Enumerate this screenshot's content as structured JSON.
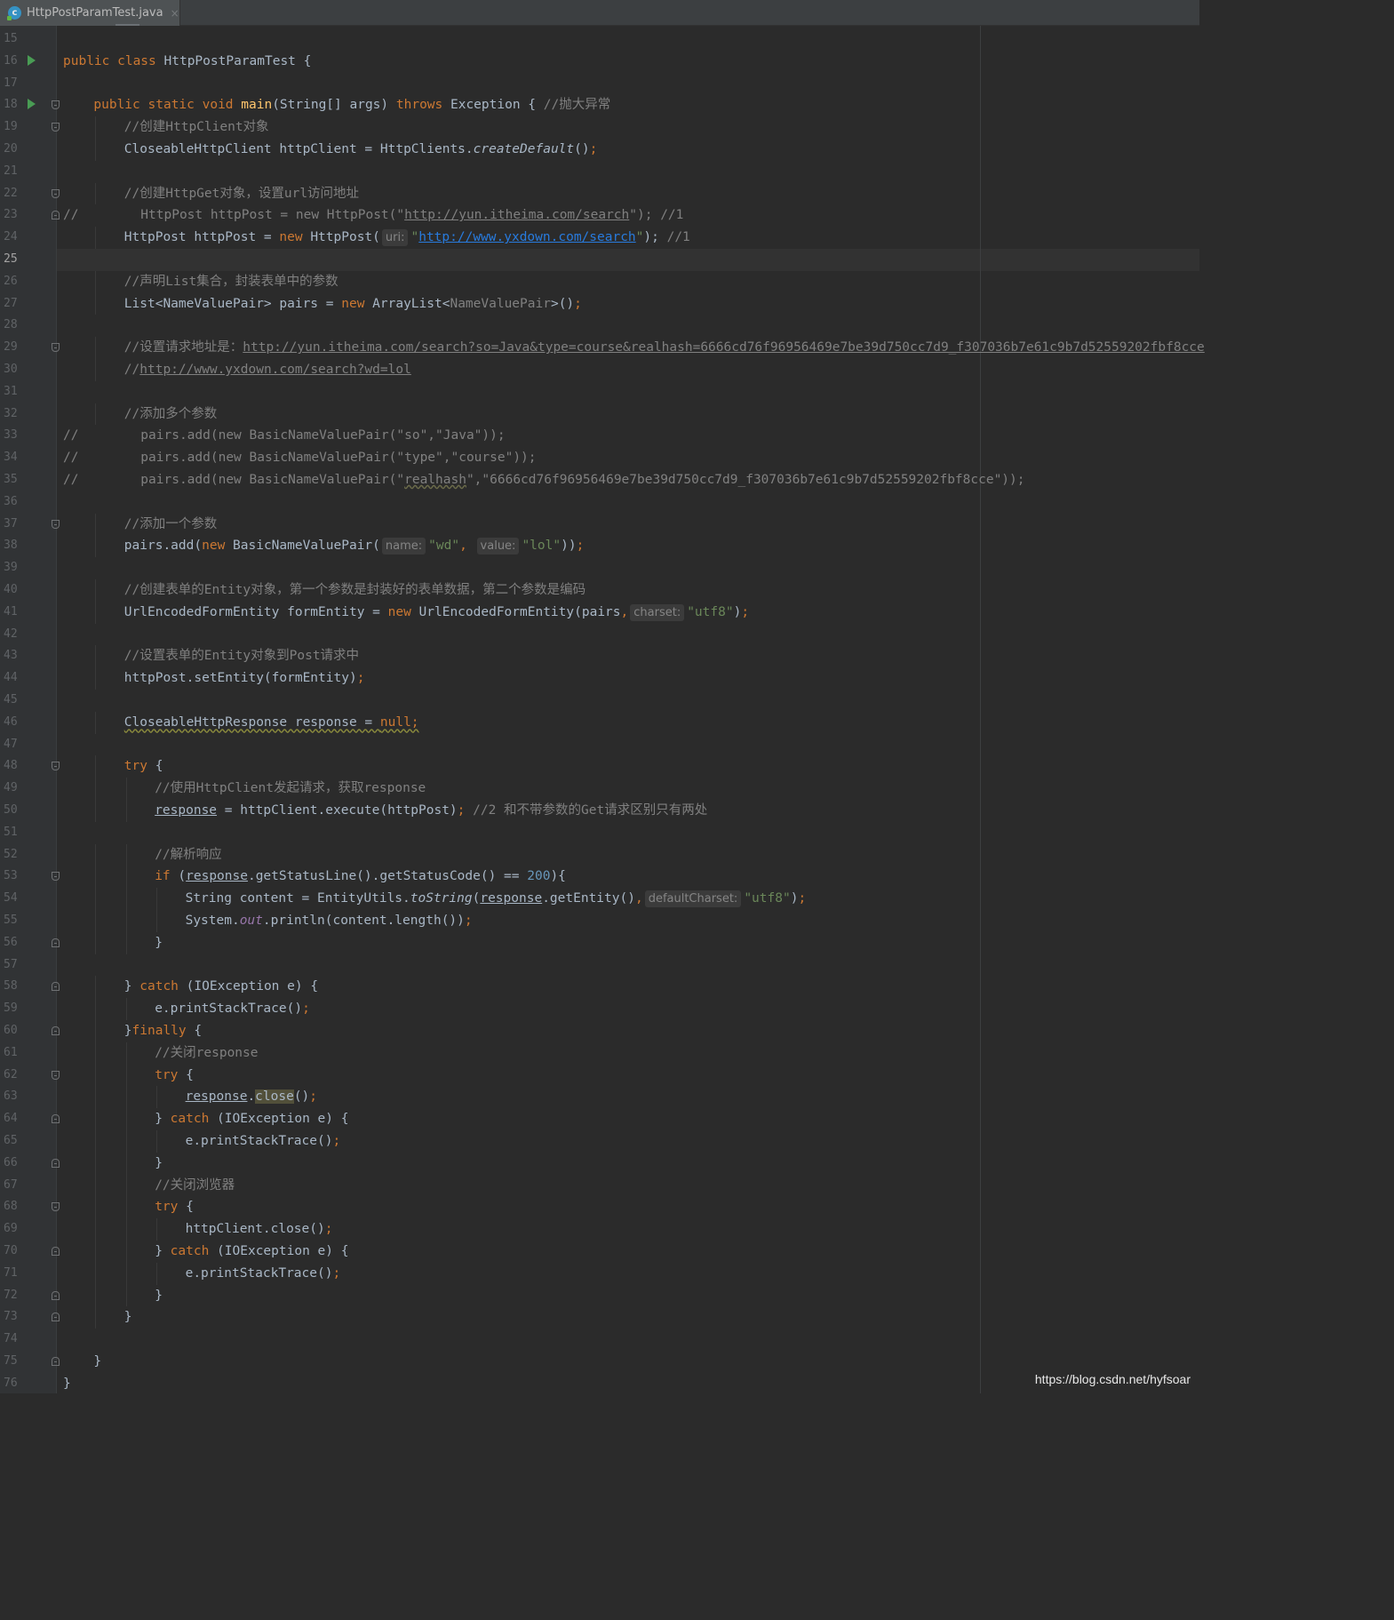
{
  "tab": {
    "filename": "HttpPostParamTest.java",
    "icon": "java-class-icon",
    "close": "×"
  },
  "current_line": 25,
  "run_marker_lines": [
    16,
    18
  ],
  "fold_lines": [
    18,
    19,
    22,
    23,
    29,
    37,
    48,
    53,
    56,
    58,
    60,
    62,
    64,
    66,
    68,
    70,
    72,
    73,
    75
  ],
  "lines": [
    {
      "n": 15,
      "indent": 0,
      "t": []
    },
    {
      "n": 16,
      "indent": 0,
      "t": [
        [
          "kw",
          "public class "
        ],
        [
          "",
          "HttpPostParamTest {"
        ]
      ]
    },
    {
      "n": 17,
      "indent": 0,
      "t": []
    },
    {
      "n": 18,
      "indent": 1,
      "t": [
        [
          "kw",
          "public static void "
        ],
        [
          "fn",
          "main"
        ],
        [
          "",
          "(String[] args) "
        ],
        [
          "kw",
          "throws "
        ],
        [
          "",
          "Exception { "
        ],
        [
          "cm",
          "//抛大异常"
        ]
      ]
    },
    {
      "n": 19,
      "indent": 2,
      "t": [
        [
          "cm",
          "//创建HttpClient对象"
        ]
      ]
    },
    {
      "n": 20,
      "indent": 2,
      "t": [
        [
          "",
          "CloseableHttpClient httpClient = HttpClients."
        ],
        [
          "it",
          "createDefault"
        ],
        [
          "",
          "()"
        ],
        [
          "kw",
          ";"
        ]
      ]
    },
    {
      "n": 21,
      "indent": 0,
      "t": []
    },
    {
      "n": 22,
      "indent": 2,
      "t": [
        [
          "cm",
          "//创建HttpGet对象，设置url访问地址"
        ]
      ]
    },
    {
      "n": 23,
      "indent": 0,
      "t": [
        [
          "cm",
          "//        HttpPost httpPost = new HttpPost(\""
        ],
        [
          "cml",
          "http://yun.itheima.com/search"
        ],
        [
          "cm",
          "\"); //1"
        ]
      ]
    },
    {
      "n": 24,
      "indent": 2,
      "t": [
        [
          "",
          "HttpPost httpPost = "
        ],
        [
          "kw",
          "new "
        ],
        [
          "",
          "HttpPost("
        ],
        [
          "hint",
          "uri:"
        ],
        [
          "str",
          "\""
        ],
        [
          "link",
          "http://www.yxdown.com/search"
        ],
        [
          "str",
          "\""
        ],
        [
          "",
          "); "
        ],
        [
          "cm",
          "//1"
        ]
      ]
    },
    {
      "n": 25,
      "indent": 0,
      "t": []
    },
    {
      "n": 26,
      "indent": 2,
      "t": [
        [
          "cm",
          "//声明List集合，封装表单中的参数"
        ]
      ]
    },
    {
      "n": 27,
      "indent": 2,
      "t": [
        [
          "",
          "List<NameValuePair> pairs = "
        ],
        [
          "kw",
          "new "
        ],
        [
          "",
          "ArrayList<"
        ],
        [
          "gen",
          "NameValuePair"
        ],
        [
          "",
          ">()"
        ],
        [
          "kw",
          ";"
        ]
      ]
    },
    {
      "n": 28,
      "indent": 0,
      "t": []
    },
    {
      "n": 29,
      "indent": 2,
      "t": [
        [
          "cm",
          "//设置请求地址是："
        ],
        [
          "cml",
          "http://yun.itheima.com/search?so=Java&type=course&realhash=6666cd76f96956469e7be39d750cc7d9_f307036b7e61c9b7d52559202fbf8cce"
        ]
      ]
    },
    {
      "n": 30,
      "indent": 2,
      "t": [
        [
          "cm",
          "//"
        ],
        [
          "cml",
          "http://www.yxdown.com/search?wd=lol"
        ]
      ]
    },
    {
      "n": 31,
      "indent": 0,
      "t": []
    },
    {
      "n": 32,
      "indent": 2,
      "t": [
        [
          "cm",
          "//添加多个参数"
        ]
      ]
    },
    {
      "n": 33,
      "indent": 0,
      "t": [
        [
          "cm",
          "//        pairs.add(new BasicNameValuePair(\"so\",\"Java\"));"
        ]
      ]
    },
    {
      "n": 34,
      "indent": 0,
      "t": [
        [
          "cm",
          "//        pairs.add(new BasicNameValuePair(\"type\",\"course\"));"
        ]
      ]
    },
    {
      "n": 35,
      "indent": 0,
      "t": [
        [
          "cm",
          "//        pairs.add(new BasicNameValuePair(\""
        ],
        [
          "cmw",
          "realhash"
        ],
        [
          "cm",
          "\",\"6666cd76f96956469e7be39d750cc7d9_f307036b7e61c9b7d52559202fbf8cce\"));"
        ]
      ]
    },
    {
      "n": 36,
      "indent": 0,
      "t": []
    },
    {
      "n": 37,
      "indent": 2,
      "t": [
        [
          "cm",
          "//添加一个参数"
        ]
      ]
    },
    {
      "n": 38,
      "indent": 2,
      "t": [
        [
          "",
          "pairs.add("
        ],
        [
          "kw",
          "new "
        ],
        [
          "",
          "BasicNameValuePair("
        ],
        [
          "hint",
          "name:"
        ],
        [
          "str",
          "\"wd\""
        ],
        [
          "kw",
          ", "
        ],
        [
          "hint",
          "value:"
        ],
        [
          "str",
          "\"lol\""
        ],
        [
          "",
          "))"
        ],
        [
          "kw",
          ";"
        ]
      ]
    },
    {
      "n": 39,
      "indent": 0,
      "t": []
    },
    {
      "n": 40,
      "indent": 2,
      "t": [
        [
          "cm",
          "//创建表单的Entity对象，第一个参数是封装好的表单数据，第二个参数是编码"
        ]
      ]
    },
    {
      "n": 41,
      "indent": 2,
      "t": [
        [
          "",
          "UrlEncodedFormEntity formEntity = "
        ],
        [
          "kw",
          "new "
        ],
        [
          "",
          "UrlEncodedFormEntity(pairs"
        ],
        [
          "kw",
          ","
        ],
        [
          "hint",
          "charset:"
        ],
        [
          "str",
          "\"utf8\""
        ],
        [
          "",
          ")"
        ],
        [
          "kw",
          ";"
        ]
      ]
    },
    {
      "n": 42,
      "indent": 0,
      "t": []
    },
    {
      "n": 43,
      "indent": 2,
      "t": [
        [
          "cm",
          "//设置表单的Entity对象到Post请求中"
        ]
      ]
    },
    {
      "n": 44,
      "indent": 2,
      "t": [
        [
          "",
          "httpPost.setEntity(formEntity)"
        ],
        [
          "kw",
          ";"
        ]
      ]
    },
    {
      "n": 45,
      "indent": 0,
      "t": []
    },
    {
      "n": 46,
      "indent": 2,
      "t": [
        [
          "warn",
          "CloseableHttpResponse response = "
        ],
        [
          "warnkw",
          "null;"
        ]
      ]
    },
    {
      "n": 47,
      "indent": 0,
      "t": []
    },
    {
      "n": 48,
      "indent": 2,
      "t": [
        [
          "kw",
          "try "
        ],
        [
          "",
          "{"
        ]
      ]
    },
    {
      "n": 49,
      "indent": 3,
      "t": [
        [
          "cm",
          "//使用HttpClient发起请求，获取response"
        ]
      ]
    },
    {
      "n": 50,
      "indent": 3,
      "t": [
        [
          "ul",
          "response"
        ],
        [
          "",
          " = httpClient.execute(httpPost)"
        ],
        [
          "kw",
          "; "
        ],
        [
          "cm",
          "//2 和不带参数的Get请求区别只有两处"
        ]
      ]
    },
    {
      "n": 51,
      "indent": 0,
      "t": []
    },
    {
      "n": 52,
      "indent": 3,
      "t": [
        [
          "cm",
          "//解析响应"
        ]
      ]
    },
    {
      "n": 53,
      "indent": 3,
      "t": [
        [
          "kw",
          "if "
        ],
        [
          "",
          "("
        ],
        [
          "ul",
          "response"
        ],
        [
          "",
          ".getStatusLine().getStatusCode() == "
        ],
        [
          "num",
          "200"
        ],
        [
          "",
          "){"
        ]
      ]
    },
    {
      "n": 54,
      "indent": 4,
      "t": [
        [
          "",
          "String content = EntityUtils."
        ],
        [
          "it",
          "toString"
        ],
        [
          "",
          "("
        ],
        [
          "ul",
          "response"
        ],
        [
          "",
          ".getEntity()"
        ],
        [
          "kw",
          ","
        ],
        [
          "hint",
          "defaultCharset:"
        ],
        [
          "str",
          "\"utf8\""
        ],
        [
          "",
          ")"
        ],
        [
          "kw",
          ";"
        ]
      ]
    },
    {
      "n": 55,
      "indent": 4,
      "t": [
        [
          "",
          "System."
        ],
        [
          "fld",
          "out"
        ],
        [
          "",
          ".println(content.length())"
        ],
        [
          "kw",
          ";"
        ]
      ]
    },
    {
      "n": 56,
      "indent": 3,
      "t": [
        [
          "",
          "}"
        ]
      ]
    },
    {
      "n": 57,
      "indent": 0,
      "t": []
    },
    {
      "n": 58,
      "indent": 2,
      "t": [
        [
          "",
          "} "
        ],
        [
          "kw",
          "catch "
        ],
        [
          "",
          "(IOException e) {"
        ]
      ]
    },
    {
      "n": 59,
      "indent": 3,
      "t": [
        [
          "",
          "e.printStackTrace()"
        ],
        [
          "kw",
          ";"
        ]
      ]
    },
    {
      "n": 60,
      "indent": 2,
      "t": [
        [
          "",
          "}"
        ],
        [
          "kw",
          "finally "
        ],
        [
          "",
          "{"
        ]
      ]
    },
    {
      "n": 61,
      "indent": 3,
      "t": [
        [
          "cm",
          "//关闭response"
        ]
      ]
    },
    {
      "n": 62,
      "indent": 3,
      "t": [
        [
          "kw",
          "try "
        ],
        [
          "",
          "{"
        ]
      ]
    },
    {
      "n": 63,
      "indent": 4,
      "t": [
        [
          "ul",
          "response"
        ],
        [
          "",
          "."
        ],
        [
          "hi",
          "close"
        ],
        [
          "",
          "()"
        ],
        [
          "kw",
          ";"
        ]
      ]
    },
    {
      "n": 64,
      "indent": 3,
      "t": [
        [
          "",
          "} "
        ],
        [
          "kw",
          "catch "
        ],
        [
          "",
          "(IOException e) {"
        ]
      ]
    },
    {
      "n": 65,
      "indent": 4,
      "t": [
        [
          "",
          "e.printStackTrace()"
        ],
        [
          "kw",
          ";"
        ]
      ]
    },
    {
      "n": 66,
      "indent": 3,
      "t": [
        [
          "",
          "}"
        ]
      ]
    },
    {
      "n": 67,
      "indent": 3,
      "t": [
        [
          "cm",
          "//关闭浏览器"
        ]
      ]
    },
    {
      "n": 68,
      "indent": 3,
      "t": [
        [
          "kw",
          "try "
        ],
        [
          "",
          "{"
        ]
      ]
    },
    {
      "n": 69,
      "indent": 4,
      "t": [
        [
          "",
          "httpClient.close()"
        ],
        [
          "kw",
          ";"
        ]
      ]
    },
    {
      "n": 70,
      "indent": 3,
      "t": [
        [
          "",
          "} "
        ],
        [
          "kw",
          "catch "
        ],
        [
          "",
          "(IOException e) {"
        ]
      ]
    },
    {
      "n": 71,
      "indent": 4,
      "t": [
        [
          "",
          "e.printStackTrace()"
        ],
        [
          "kw",
          ";"
        ]
      ]
    },
    {
      "n": 72,
      "indent": 3,
      "t": [
        [
          "",
          "}"
        ]
      ]
    },
    {
      "n": 73,
      "indent": 2,
      "t": [
        [
          "",
          "}"
        ]
      ]
    },
    {
      "n": 74,
      "indent": 0,
      "t": []
    },
    {
      "n": 75,
      "indent": 1,
      "t": [
        [
          "",
          "}"
        ]
      ]
    },
    {
      "n": 76,
      "indent": 0,
      "t": [
        [
          "",
          "}"
        ]
      ]
    }
  ],
  "watermark": "https://blog.csdn.net/hyfsoar"
}
